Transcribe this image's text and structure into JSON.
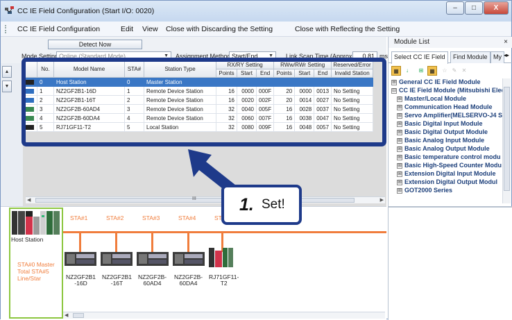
{
  "window": {
    "title": "CC IE Field Configuration (Start I/O: 0020)",
    "minimize": "–",
    "maximize": "□",
    "close": "X"
  },
  "menu": {
    "items": [
      "CC IE Field Configuration",
      "Edit",
      "View",
      "Close with Discarding the Setting",
      "Close with Reflecting the Setting"
    ]
  },
  "toolbar": {
    "detect_now": "Detect Now",
    "mode_label": "Mode Setting:",
    "mode_value": "Online (Standard Mode)",
    "assign_label": "Assignment Method:",
    "assign_value": "Start/End",
    "scan_label": "Link Scan Time (Approx.):",
    "scan_value": "0.81",
    "scan_unit": "ms"
  },
  "grid": {
    "headers": {
      "no": "No.",
      "model": "Model Name",
      "sta": "STA#",
      "type": "Station Type",
      "rxry": "RX/RY Setting",
      "rwwrwr": "RWw/RWr Setting",
      "reserved": "Reserved/Error",
      "reserved2": "Invalid Station",
      "points": "Points",
      "start": "Start",
      "end": "End"
    },
    "rows": [
      {
        "no": "0",
        "model": "Host Station",
        "sta": "0",
        "type": "Master Station",
        "rx_points": "",
        "rx_start": "",
        "rx_end": "",
        "rw_points": "",
        "rw_start": "",
        "rw_end": "",
        "reserved": ""
      },
      {
        "no": "1",
        "model": "NZ2GF2B1-16D",
        "sta": "1",
        "type": "Remote Device Station",
        "rx_points": "16",
        "rx_start": "0000",
        "rx_end": "000F",
        "rw_points": "20",
        "rw_start": "0000",
        "rw_end": "0013",
        "reserved": "No Setting"
      },
      {
        "no": "2",
        "model": "NZ2GF2B1-16T",
        "sta": "2",
        "type": "Remote Device Station",
        "rx_points": "16",
        "rx_start": "0020",
        "rx_end": "002F",
        "rw_points": "20",
        "rw_start": "0014",
        "rw_end": "0027",
        "reserved": "No Setting"
      },
      {
        "no": "3",
        "model": "NZ2GF2B-60AD4",
        "sta": "3",
        "type": "Remote Device Station",
        "rx_points": "32",
        "rx_start": "0040",
        "rx_end": "005F",
        "rw_points": "16",
        "rw_start": "0028",
        "rw_end": "0037",
        "reserved": "No Setting"
      },
      {
        "no": "4",
        "model": "NZ2GF2B-60DA4",
        "sta": "4",
        "type": "Remote Device Station",
        "rx_points": "32",
        "rx_start": "0060",
        "rx_end": "007F",
        "rw_points": "16",
        "rw_start": "0038",
        "rw_end": "0047",
        "reserved": "No Setting"
      },
      {
        "no": "5",
        "model": "RJ71GF11-T2",
        "sta": "5",
        "type": "Local Station",
        "rx_points": "32",
        "rx_start": "0080",
        "rx_end": "009F",
        "rw_points": "16",
        "rw_start": "0048",
        "rw_end": "0057",
        "reserved": "No Setting"
      }
    ]
  },
  "hscroll": {
    "grip": "III"
  },
  "topology": {
    "host_label": "Host Station",
    "host_info": [
      "STA#0  Master",
      "Total STA#5",
      "Line/Star"
    ],
    "sta_labels": [
      "STA#1",
      "STA#2",
      "STA#3",
      "STA#4",
      "ST"
    ],
    "devices": [
      "NZ2GF2B1\n-16D",
      "NZ2GF2B1\n-16T",
      "NZ2GF2B-\n60AD4",
      "NZ2GF2B-\n60DA4",
      "RJ71GF11-\nT2"
    ]
  },
  "callout": {
    "number": "1.",
    "text": "Set!"
  },
  "module_list": {
    "title": "Module List",
    "tabs": [
      "Select CC IE Field",
      "Find Module",
      "My"
    ],
    "tree": [
      {
        "sign": "⊞",
        "label": "General CC IE Field Module"
      },
      {
        "sign": "⊟",
        "label": "CC IE Field Module (Mitsubishi Electric)"
      },
      {
        "sign": "⊞",
        "label": "Master/Local Module"
      },
      {
        "sign": "⊞",
        "label": "Communication Head Module"
      },
      {
        "sign": "⊞",
        "label": "Servo Amplifier(MELSERVO-J4 S"
      },
      {
        "sign": "⊞",
        "label": "Basic Digital Input Module"
      },
      {
        "sign": "⊞",
        "label": "Basic Digital Output Module"
      },
      {
        "sign": "⊞",
        "label": "Basic Analog Input Module"
      },
      {
        "sign": "⊞",
        "label": "Basic Analog Output Module"
      },
      {
        "sign": "⊞",
        "label": "Basic temperature control modu"
      },
      {
        "sign": "⊞",
        "label": "Basic High-Speed Counter Modu"
      },
      {
        "sign": "⊞",
        "label": "Extension Digital Input Module"
      },
      {
        "sign": "⊞",
        "label": "Extension Digital Output Modul"
      },
      {
        "sign": "⊞",
        "label": "GOT2000 Series"
      }
    ]
  }
}
